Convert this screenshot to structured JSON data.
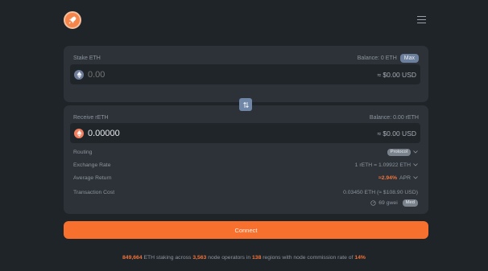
{
  "header": {
    "logo_icon": "rocket-icon",
    "menu_icon": "hamburger-menu-icon"
  },
  "stake": {
    "label": "Stake ETH",
    "balance": "Balance: 0 ETH",
    "max_label": "Max",
    "token_icon": "ethereum-icon",
    "amount_placeholder": "0.00",
    "usd": "≈ $0.00 USD"
  },
  "swap_icon": "swap-arrows-icon",
  "receive": {
    "label": "Receive rETH",
    "balance": "Balance: 0.00 rETH",
    "token_icon": "reth-icon",
    "amount": "0.00000",
    "usd": "≈ $0.00 USD",
    "details": {
      "routing_label": "Routing",
      "routing_value": "Protocol",
      "exchange_label": "Exchange Rate",
      "exchange_value": "1 rETH = 1.09922 ETH",
      "return_label": "Average Return",
      "return_approx": "≈",
      "return_value": "2.94%",
      "return_unit": "APR",
      "cost_label": "Transaction Cost",
      "cost_value": "0.03450 ETH (≈ $108.90 USD)",
      "gas_value": "69 gwei",
      "gas_speed": "Med"
    }
  },
  "connect_label": "Connect",
  "footer": {
    "staked": "849,664",
    "t1": " ETH staking across ",
    "operators": "3,563",
    "t2": " node operators in ",
    "regions": "138",
    "t3": " regions with node commission rate of ",
    "commission": "14%"
  },
  "colors": {
    "accent": "#f8702e",
    "background": "#1f2429",
    "card": "#2c3238"
  }
}
